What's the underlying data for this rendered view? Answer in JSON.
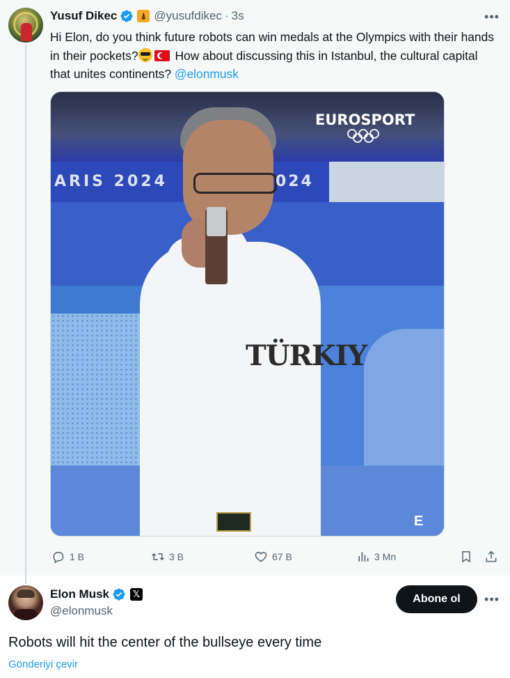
{
  "parent_tweet": {
    "author_name": "Yusuf Dikec",
    "handle": "@yusufdikec",
    "separator": "·",
    "time": "3s",
    "text_part1": "Hi Elon, do you think future robots can win medals at the Olympics with their hands in their pockets?",
    "text_part2": " How about discussing this in Istanbul, the cultural capital that unites continents? ",
    "mention": "@elonmusk",
    "media": {
      "overlay_paris": "ARIS 2024",
      "overlay_2024": "024",
      "overlay_brand": "EUROSPORT",
      "shirt_text": "TÜRKIY",
      "corner_mark": "E"
    },
    "actions": {
      "replies": "1 B",
      "retweets": "3 B",
      "likes": "67 B",
      "views": "3 Mn"
    }
  },
  "main_tweet": {
    "author_name": "Elon Musk",
    "handle": "@elonmusk",
    "follow_label": "Abone ol",
    "text": "Robots will hit the center of the bullseye every time",
    "translate_label": "Gönderiyi çevir"
  },
  "colors": {
    "accent": "#1d9bf0",
    "muted": "#536471",
    "text": "#0f1419",
    "parent_bg": "#f7f9f9"
  },
  "icons": {
    "verified": "verified-badge-icon",
    "tower": "eiffel-tower-emoji-icon",
    "x": "x-logo-icon",
    "reply": "reply-icon",
    "retweet": "retweet-icon",
    "like": "heart-icon",
    "views": "views-chart-icon",
    "bookmark": "bookmark-icon",
    "share": "share-icon",
    "more": "more-dots-icon"
  }
}
